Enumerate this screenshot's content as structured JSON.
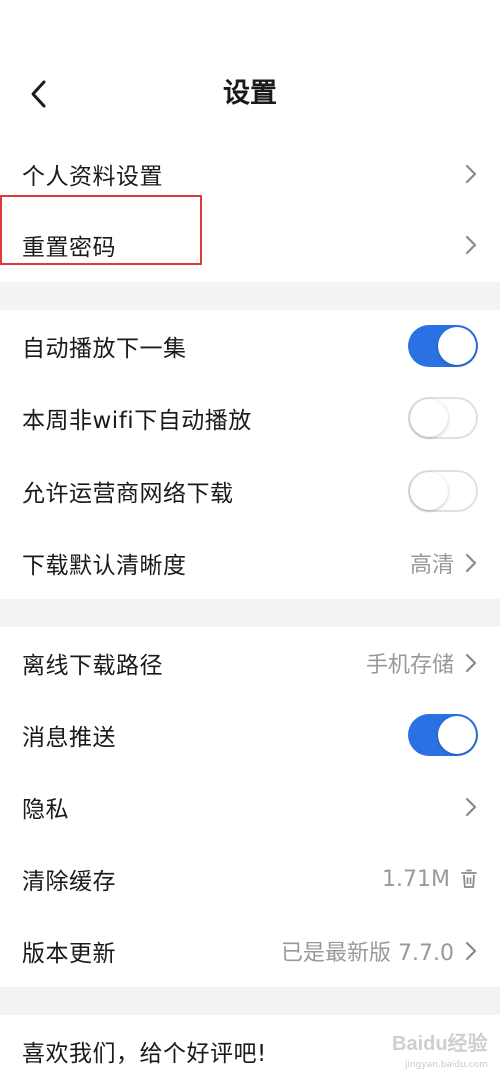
{
  "header": {
    "title": "设置"
  },
  "sections": {
    "account": {
      "profile_label": "个人资料设置",
      "reset_password_label": "重置密码"
    },
    "playback": {
      "autoplay_next_label": "自动播放下一集",
      "autoplay_next_on": true,
      "non_wifi_autoplay_label": "本周非wifi下自动播放",
      "non_wifi_autoplay_on": false,
      "carrier_download_label": "允许运营商网络下载",
      "carrier_download_on": false,
      "default_quality_label": "下载默认清晰度",
      "default_quality_value": "高清"
    },
    "general": {
      "offline_path_label": "离线下载路径",
      "offline_path_value": "手机存储",
      "push_label": "消息推送",
      "push_on": true,
      "privacy_label": "隐私",
      "clear_cache_label": "清除缓存",
      "cache_size_value": "1.71M",
      "version_label": "版本更新",
      "version_value": "已是最新版 7.7.0"
    },
    "feedback": {
      "rate_label": "喜欢我们，给个好评吧!"
    }
  },
  "watermark": {
    "brand": "Baidu经验",
    "url": "jingyan.baidu.com"
  },
  "colors": {
    "toggle_on": "#2a72e3",
    "value_text": "#999999",
    "band": "#f3f3f3",
    "highlight": "#e03a3a"
  }
}
